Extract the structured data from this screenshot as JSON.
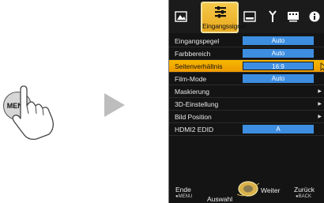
{
  "illustration": {
    "menu_button_label": "MENU"
  },
  "tabs": {
    "active_label": "Eingangssignal",
    "icons": [
      "picture-icon",
      "input-signal-icon",
      "installation-icon",
      "display-setup-icon",
      "function-icon",
      "info-icon"
    ]
  },
  "menu": {
    "items": [
      {
        "label": "Eingangspegel",
        "value": "Auto"
      },
      {
        "label": "Farbbereich",
        "value": "Auto"
      },
      {
        "label": "Seitenverhältnis",
        "value": "16:9",
        "selected": true
      },
      {
        "label": "Film-Mode",
        "value": "Auto"
      },
      {
        "label": "Maskierung",
        "submenu": true
      },
      {
        "label": "3D-Einstellung",
        "submenu": true
      },
      {
        "label": "Bild Position",
        "submenu": true
      },
      {
        "label": "HDMI2 EDID",
        "value": "A"
      }
    ]
  },
  "footer": {
    "exit_label": "Ende",
    "exit_sub": "●MENU",
    "select_label": "Auswahl",
    "next_label": "Weiter",
    "back_label": "Zurück",
    "back_sub": "●BACK"
  },
  "colors": {
    "accent": "#f7b800",
    "value_bg": "#3d8ee0",
    "panel_bg": "#141414"
  }
}
